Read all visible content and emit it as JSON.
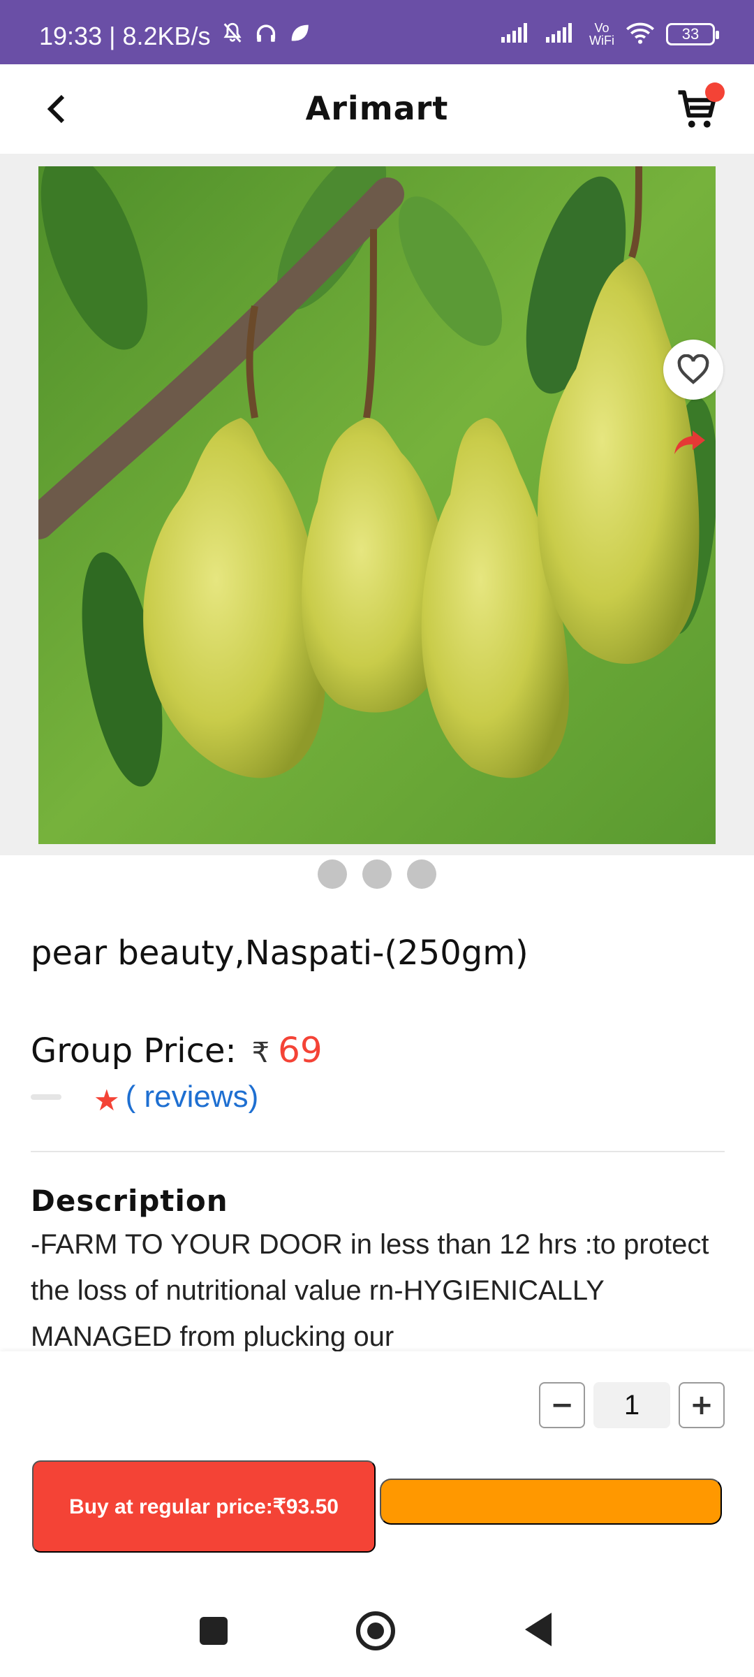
{
  "status_bar": {
    "time_speed": "19:33 | 8.2KB/s",
    "vowifi_top": "Vo",
    "vowifi_bottom": "WiFi",
    "battery": "33"
  },
  "header": {
    "title": "Arimart",
    "back_icon": "chevron-left-icon",
    "cart_icon": "cart-icon",
    "cart_badge_color": "#f44336"
  },
  "product": {
    "image_alt": "pears",
    "image_count": 3,
    "name": "pear beauty,Naspati-(250gm)",
    "price_label": "Group Price:",
    "currency": "₹",
    "price": "69",
    "reviews_text": "( reviews)",
    "wishlist_icon": "heart-icon",
    "share_icon": "share-icon"
  },
  "description": {
    "title": "Description",
    "body": "-FARM TO YOUR DOOR in less than 12 hrs :to protect the loss of nutritional value rn-HYGIENICALLY MANAGED from plucking our"
  },
  "cart_controls": {
    "minus_label": "−",
    "quantity": "1",
    "plus_label": "+",
    "buy_regular_label": "Buy at regular price:₹93.50",
    "buy_group_label": ""
  },
  "colors": {
    "status_bar": "#6a4fa6",
    "accent_red": "#f44336",
    "accent_orange": "#ff9800",
    "link_blue": "#1e6fd1"
  }
}
